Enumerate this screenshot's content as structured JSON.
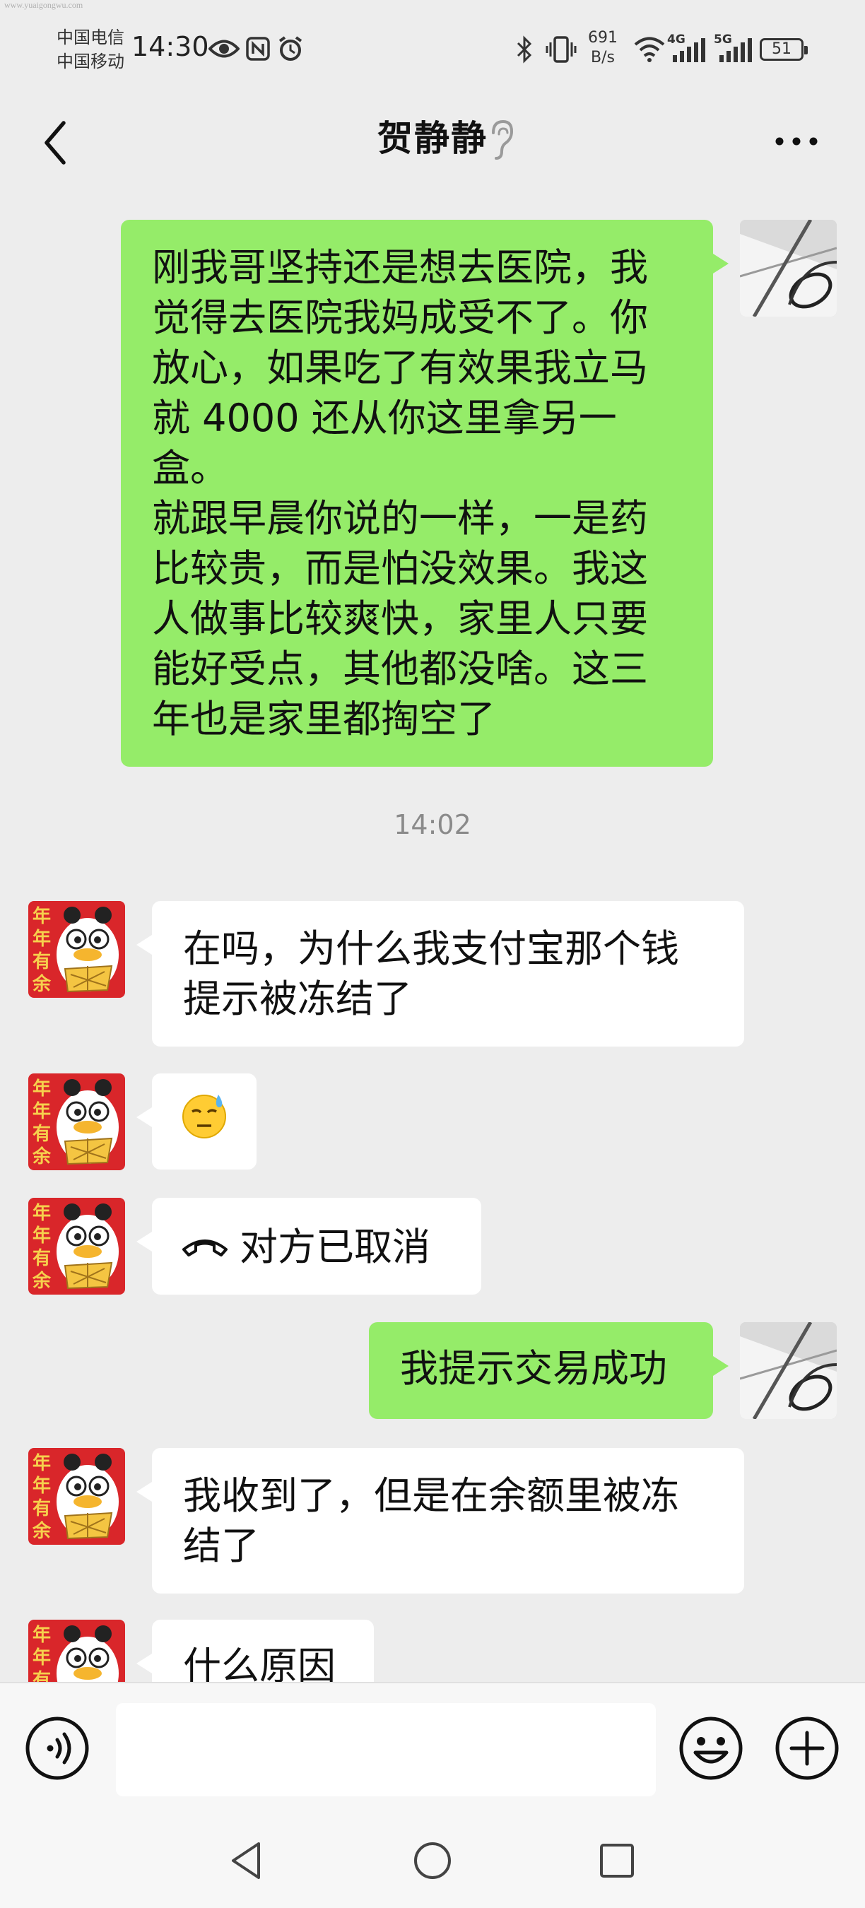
{
  "watermark": "www.yuaigongwu.com",
  "status_bar": {
    "carrier_1": "中国电信",
    "carrier_2": "中国移动",
    "time": "14:30",
    "net_speed_value": "691",
    "net_speed_unit": "B/s",
    "battery": "51",
    "signal_1_label": "4G",
    "signal_2_label": "5G"
  },
  "header": {
    "title": "贺静静"
  },
  "messages": [
    {
      "side": "right",
      "type": "text",
      "lines": [
        "刚我哥坚持还是想去医院，我",
        "觉得去医院我妈成受不了。你",
        "放心，如果吃了有效果我立马",
        "就 4000 还从你这里拿另一盒。",
        "就跟早晨你说的一样，一是药",
        "比较贵，而是怕没效果。我这",
        "人做事比较爽快，家里人只要",
        "能好受点，其他都没啥。这三",
        "年也是家里都掏空了"
      ]
    },
    {
      "type": "timestamp",
      "text": "14:02"
    },
    {
      "side": "left",
      "type": "text",
      "lines": [
        "在吗，为什么我支付宝那个钱",
        "提示被冻结了"
      ]
    },
    {
      "side": "left",
      "type": "emoji",
      "emoji": "😓"
    },
    {
      "side": "left",
      "type": "call",
      "text": "对方已取消"
    },
    {
      "side": "right",
      "type": "text",
      "lines": [
        "我提示交易成功"
      ]
    },
    {
      "side": "left",
      "type": "text",
      "lines": [
        "我收到了，但是在余额里被冻",
        "结了"
      ]
    },
    {
      "side": "left",
      "type": "text",
      "lines": [
        "什么原因"
      ]
    }
  ],
  "avatar_text": "年年有余",
  "colors": {
    "green_bubble": "#95ec69",
    "white_bubble": "#ffffff",
    "background": "#ededed",
    "avatar_red": "#d9262a"
  }
}
